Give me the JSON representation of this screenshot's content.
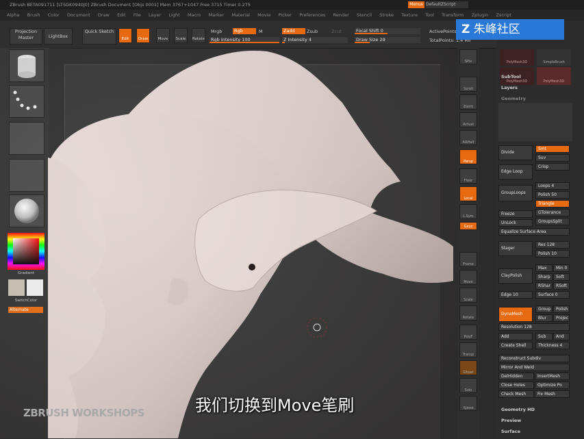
{
  "window": {
    "title": "ZBrush BETA091711 [LTSGK0940J0]   ZBrush Document     [Objs 0001] Mem 3767+1047  Free 3715  Timer 0.275"
  },
  "menubar": {
    "items": [
      "Alpha",
      "Brush",
      "Color",
      "Document",
      "Draw",
      "Edit",
      "File",
      "Layer",
      "Light",
      "Macro",
      "Marker",
      "Material",
      "Movie",
      "Picker",
      "Preferences",
      "Render",
      "Stencil",
      "Stroke",
      "Texture",
      "Tool",
      "Transform",
      "Zplugin",
      "Zscript"
    ],
    "menus_btn": "Menus",
    "script_label": "DefaultZScript"
  },
  "toolbar": {
    "projection_master": "Projection Master",
    "lightbox": "LightBox",
    "quick_sketch": "Quick Sketch",
    "edit": "Edit",
    "draw": "Draw",
    "move": "Move",
    "scale": "Scale",
    "rotate": "Rotate",
    "mrgb": "Mrgb",
    "rgb": "Rgb",
    "m": "M",
    "rgb_intensity": "Rgb Intensity 100",
    "zadd": "Zadd",
    "zsub": "Zsub",
    "zcut": "Zcut",
    "z_intensity": "Z Intensity 4",
    "focal_shift": "Focal Shift 0",
    "draw_size": "Draw Size 29",
    "active_points": "ActivePoints:",
    "total_points": "TotalPoints: 1.4 Mil"
  },
  "toolbar_values": {
    "rgb_intensity": 100,
    "z_intensity": 4,
    "focal_shift": 0,
    "draw_size": 29
  },
  "leftshelf": {
    "gradient": "Gradient",
    "switch_color": "SwitchColor",
    "alternate": "Alternate"
  },
  "rightshelf": {
    "labels": [
      "SPix",
      "Scroll",
      "Zoom",
      "Actual",
      "AAHalf",
      "Persp",
      "Floor",
      "Local",
      "L.Sym",
      "Gxyz",
      "Frame",
      "Move",
      "Scale",
      "Rotate",
      "PolyF",
      "Transp",
      "Ghost",
      "Solo",
      "Xpose"
    ]
  },
  "palette": {
    "subtool": "SubTool",
    "layers": "Layers",
    "geometry": "Geometry",
    "divide": "Divide",
    "smt": "Smt",
    "suv": "Suv",
    "crisp": "Crisp",
    "edge_loop": "Edge Loop",
    "group_loops": "GroupLoops",
    "loops": "Loops 4",
    "polish": "Polish 50",
    "triangle": "Triangle",
    "gtolerance": "GTolerance",
    "groups_split": "GroupsSplit",
    "unlock": "UnLock",
    "freeze": "Freeze",
    "equalize_surface_area": "Equalize Surface Area",
    "stager": "Stager",
    "res": "Res 128",
    "polish_10": "Polish 10",
    "clay_polish": "ClayPolish",
    "max": "Max",
    "min_0": "Min 0",
    "sharpen": "Sharp",
    "soft": "Soft",
    "rshar": "RShar",
    "rsoft": "RSoft",
    "edge_10": "Edge 10",
    "surface_0": "Surface 0",
    "dynamesh": "DynaMesh",
    "group": "Group",
    "polish_dyn": "Polish",
    "blur": "Blur",
    "project": "Projec",
    "resolution": "Resolution 128",
    "add": "Add",
    "sub": "Sub",
    "and": "And",
    "create_shell": "Create Shell",
    "thickness": "Thickness 4",
    "reconstruct_subdiv": "Reconstruct Subdiv",
    "mirror_weld": "Mirror And Weld",
    "del_hidden": "DelHidden",
    "insert_mesh": "InsertMesh",
    "close_holes": "Close Holes",
    "optimize_points": "Optimize Po",
    "check_mesh": "Check Mesh",
    "fix_mesh": "Fix Mesh",
    "geometry_hd": "Geometry HD",
    "preview": "Preview",
    "surface": "Surface",
    "tool_slots": [
      "PolyMesh3D",
      "SimpleBrush",
      "PolyMesh3D",
      "PolyMesh3D"
    ]
  },
  "overlay": {
    "watermark": "朱峰社区",
    "subtitle": "我们切换到Move笔刷",
    "workshops": "ZBRUSH WORKSHOPS"
  },
  "colors": {
    "accent": "#e86a10",
    "watermark_blue": "#2a78d8",
    "sculpt": "#ddd0ce"
  }
}
